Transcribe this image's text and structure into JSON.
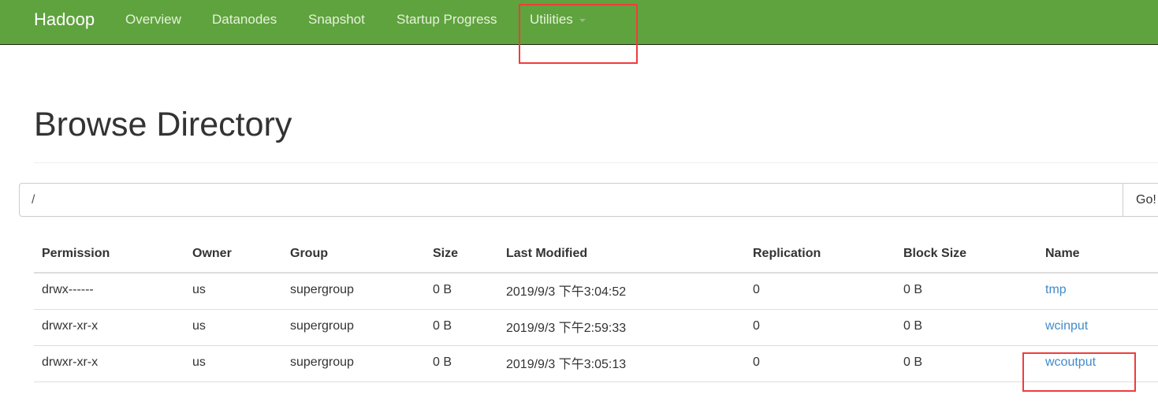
{
  "nav": {
    "brand": "Hadoop",
    "items": [
      "Overview",
      "Datanodes",
      "Snapshot",
      "Startup Progress",
      "Utilities"
    ]
  },
  "page": {
    "title": "Browse Directory",
    "path_value": "/",
    "go_label": "Go!"
  },
  "table": {
    "headers": [
      "Permission",
      "Owner",
      "Group",
      "Size",
      "Last Modified",
      "Replication",
      "Block Size",
      "Name"
    ],
    "rows": [
      [
        "drwx------",
        "us",
        "supergroup",
        "0 B",
        "2019/9/3 下午3:04:52",
        "0",
        "0 B",
        "tmp"
      ],
      [
        "drwxr-xr-x",
        "us",
        "supergroup",
        "0 B",
        "2019/9/3 下午2:59:33",
        "0",
        "0 B",
        "wcinput"
      ],
      [
        "drwxr-xr-x",
        "us",
        "supergroup",
        "0 B",
        "2019/9/3 下午3:05:13",
        "0",
        "0 B",
        "wcoutput"
      ]
    ]
  },
  "colors": {
    "navbar": "#5fa33e",
    "link": "#428bca",
    "annotation": "#f03c3c"
  }
}
